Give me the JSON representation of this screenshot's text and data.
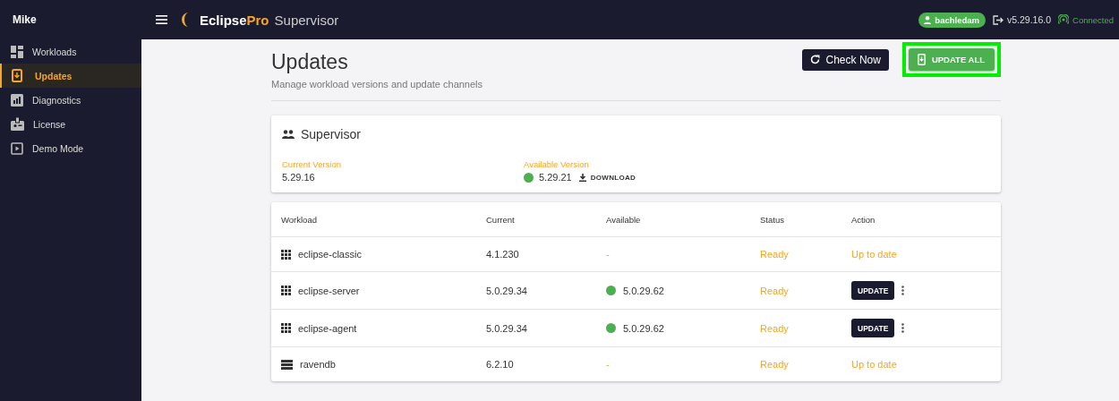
{
  "sidebar": {
    "user": "Mike",
    "items": [
      {
        "label": "Workloads",
        "selected": false
      },
      {
        "label": "Updates",
        "selected": true
      },
      {
        "label": "Diagnostics",
        "selected": false
      },
      {
        "label": "License",
        "selected": false
      },
      {
        "label": "Demo Mode",
        "selected": false
      }
    ]
  },
  "topbar": {
    "brand": "Eclipse",
    "brand_accent": "Pro",
    "product": "Supervisor",
    "user": "bachledam",
    "version": "v5.29.16.0",
    "connection": "Connected"
  },
  "page": {
    "title": "Updates",
    "subtitle": "Manage workload versions and update channels",
    "buttons": [
      {
        "label": "Check Now",
        "kind": "refresh",
        "highlighted": false
      },
      {
        "label": "UPDATE ALL",
        "kind": "update",
        "highlighted": true
      }
    ]
  },
  "supervisor": {
    "title": "Supervisor",
    "current_label": "Current Version",
    "current": "5.29.16",
    "available_label": "Available Version",
    "available": "5.29.21",
    "download": "DOWNLOAD"
  },
  "table": {
    "columns": [
      "Workload",
      "Current",
      "Available",
      "Status",
      "Action"
    ],
    "rows": [
      {
        "kind": "grid",
        "name": "eclipse-classic",
        "current": "4.1.230",
        "available": "-",
        "status": "Ready",
        "action": {
          "kind": "text",
          "label": "Up to date"
        }
      },
      {
        "kind": "grid",
        "name": "eclipse-server",
        "current": "5.0.29.34",
        "available": "5.0.29.62",
        "color": "#4caf50",
        "status": "Ready",
        "action": {
          "kind": "button",
          "label": "UPDATE"
        }
      },
      {
        "kind": "grid",
        "name": "eclipse-agent",
        "current": "5.0.29.34",
        "available": "5.0.29.62",
        "color": "#4caf50",
        "status": "Ready",
        "action": {
          "kind": "button",
          "label": "UPDATE"
        }
      },
      {
        "kind": "server",
        "name": "ravendb",
        "current": "6.2.10",
        "available": "-",
        "status": "Ready",
        "action": {
          "kind": "text",
          "label": "Up to date"
        }
      }
    ]
  }
}
